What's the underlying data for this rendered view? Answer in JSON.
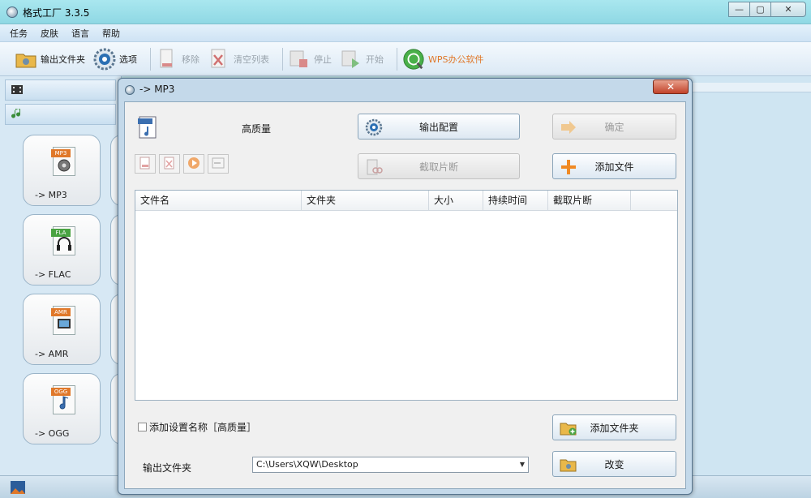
{
  "window": {
    "title": "格式工厂 3.3.5",
    "minimize": "▭",
    "restore": "▢",
    "close": "✕"
  },
  "menu": [
    "任务",
    "皮肤",
    "语言",
    "帮助"
  ],
  "toolbar": {
    "output_folder": "输出文件夹",
    "options": "选项",
    "remove": "移除",
    "clear_list": "清空列表",
    "stop": "停止",
    "start": "开始",
    "wps": "WPS办公软件"
  },
  "formats": [
    {
      "tag": "MP3",
      "label": "-> MP3",
      "color": "#e0782a"
    },
    {
      "tag": "FLA",
      "label": "-> FLAC",
      "color": "#4aa342"
    },
    {
      "tag": "AMR",
      "label": "-> AMR",
      "color": "#e0782a"
    },
    {
      "tag": "OGG",
      "label": "-> OGG",
      "color": "#e0782a"
    }
  ],
  "dialog": {
    "title": "-> MP3",
    "quality": "高质量",
    "output_config": "输出配置",
    "ok": "确定",
    "clip": "截取片断",
    "add_file": "添加文件",
    "columns": [
      "文件名",
      "文件夹",
      "大小",
      "持续时间",
      "截取片断"
    ],
    "add_setting_name": "添加设置名称［高质量］",
    "add_folder": "添加文件夹",
    "output_folder_label": "输出文件夹",
    "output_path": "C:\\Users\\XQW\\Desktop",
    "change": "改变",
    "close_glyph": "✕"
  },
  "colors": {
    "accent": "#e0782a",
    "titlebar": "#9fe0ea",
    "dialog_close": "#c2432a"
  }
}
